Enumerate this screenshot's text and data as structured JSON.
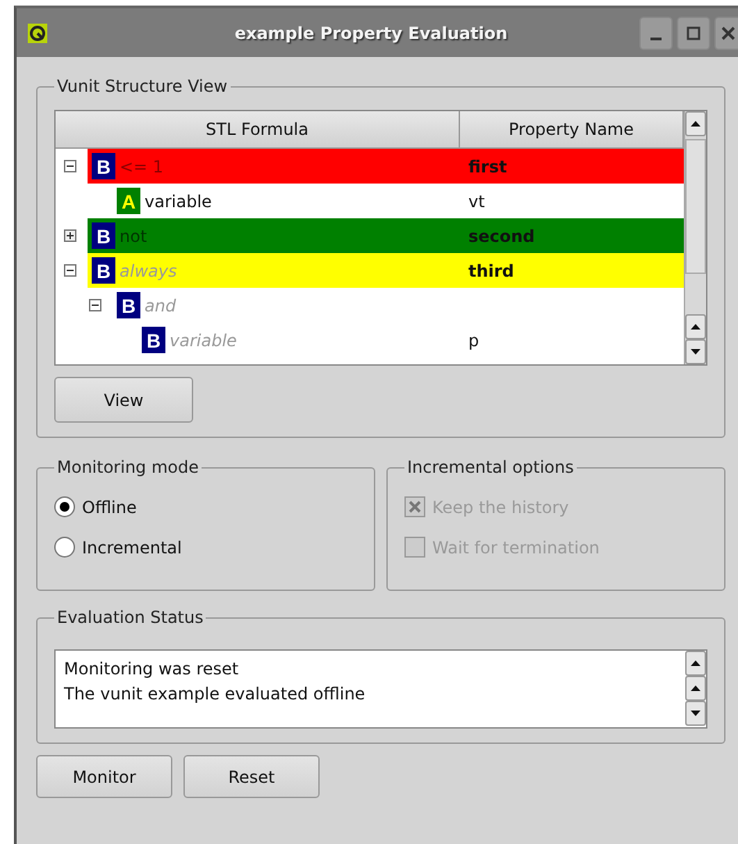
{
  "window": {
    "title": "example Property Evaluation"
  },
  "structure_view": {
    "title": "Vunit Structure View",
    "columns": [
      "STL Formula",
      "Property Name"
    ],
    "rows": [
      {
        "badge": {
          "letter": "B",
          "color": "#000080"
        },
        "formula": "<= 1",
        "property": "first",
        "color": "#ff0000",
        "italic": false,
        "expanded": true,
        "children": [
          {
            "badge": {
              "letter": "A",
              "color": "#008000"
            },
            "formula": "variable",
            "property": "vt",
            "color": "#ffffff",
            "italic": false
          }
        ]
      },
      {
        "badge": {
          "letter": "B",
          "color": "#000080"
        },
        "formula": "not",
        "property": "second",
        "color": "#008000",
        "italic": false,
        "expanded": false
      },
      {
        "badge": {
          "letter": "B",
          "color": "#000080"
        },
        "formula": "always",
        "property": "third",
        "color": "#ffff00",
        "italic": true,
        "expanded": true,
        "children": [
          {
            "badge": {
              "letter": "B",
              "color": "#000080"
            },
            "formula": "and",
            "color": "#ffffff",
            "italic": true,
            "expanded": true,
            "children": [
              {
                "badge": {
                  "letter": "B",
                  "color": "#000080"
                },
                "formula": "variable",
                "property": "p",
                "color": "#ffffff",
                "italic": true
              }
            ]
          }
        ]
      }
    ],
    "view_button": "View"
  },
  "monitoring_mode": {
    "title": "Monitoring mode",
    "options": [
      {
        "label": "Offline",
        "selected": true
      },
      {
        "label": "Incremental",
        "selected": false
      }
    ]
  },
  "incremental_options": {
    "title": "Incremental options",
    "disabled": true,
    "options": [
      {
        "label": "Keep the history",
        "checked": true
      },
      {
        "label": "Wait for termination",
        "checked": false
      }
    ]
  },
  "evaluation_status": {
    "title": "Evaluation Status",
    "lines": [
      "Monitoring was reset",
      "The vunit example evaluated offline"
    ]
  },
  "buttons": [
    "Monitor",
    "Reset"
  ]
}
